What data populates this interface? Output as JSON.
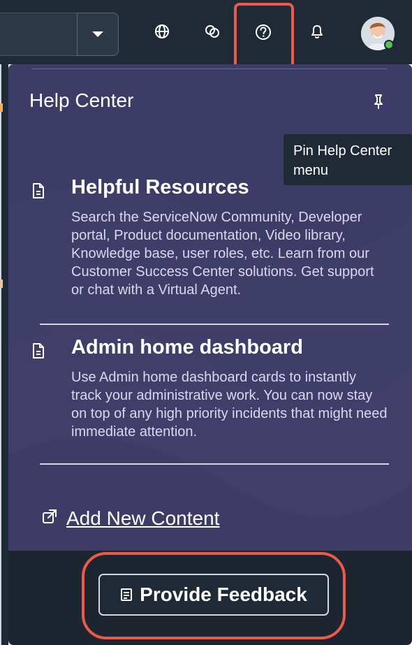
{
  "colors": {
    "top_bar": "#1f2a36",
    "panel_background": "#3d3c67",
    "panel_text": "#ffffff",
    "description_text": "#dad7ee",
    "highlight": "#ec5a4b",
    "footer": "#1c2530",
    "online_status": "#57c257"
  },
  "top_bar": {
    "dropdown_icon": "chevron-down-icon",
    "icons": [
      {
        "name": "globe-icon"
      },
      {
        "name": "chat-icon"
      },
      {
        "name": "help-icon"
      },
      {
        "name": "bell-icon"
      }
    ],
    "avatar_icon": "user-avatar-icon"
  },
  "help_center": {
    "title": "Help Center",
    "pin_icon": "pin-icon",
    "pin_tooltip": "Pin Help Center menu",
    "items": [
      {
        "icon": "document-icon",
        "title": "Helpful Resources",
        "description": "Search the ServiceNow Community, Developer portal, Product documentation, Video library, Knowledge base, user roles, etc. Learn from our Customer Success Center solutions. Get support or chat with a Virtual Agent."
      },
      {
        "icon": "document-icon",
        "title": "Admin home dashboard",
        "description": "Use Admin home dashboard cards to instantly track your administrative work. You can now stay on top of any high priority incidents that might need immediate attention."
      }
    ],
    "add_content": {
      "icon": "external-link-icon",
      "label": "Add New Content"
    },
    "feedback_button": {
      "icon": "feedback-icon",
      "label": "Provide Feedback"
    }
  }
}
